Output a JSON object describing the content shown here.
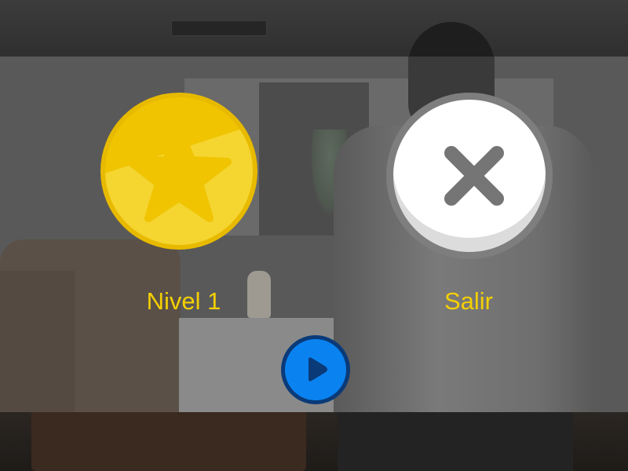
{
  "level_button": {
    "label": "Nivel 1",
    "icon": "star-icon",
    "color": "#f0c400"
  },
  "exit_button": {
    "label": "Salir",
    "icon": "close-icon",
    "color": "#ffffff"
  },
  "play_button": {
    "icon": "play-icon",
    "color": "#0a83f0"
  },
  "colors": {
    "label_text": "#f5d000",
    "overlay": "#595959"
  }
}
